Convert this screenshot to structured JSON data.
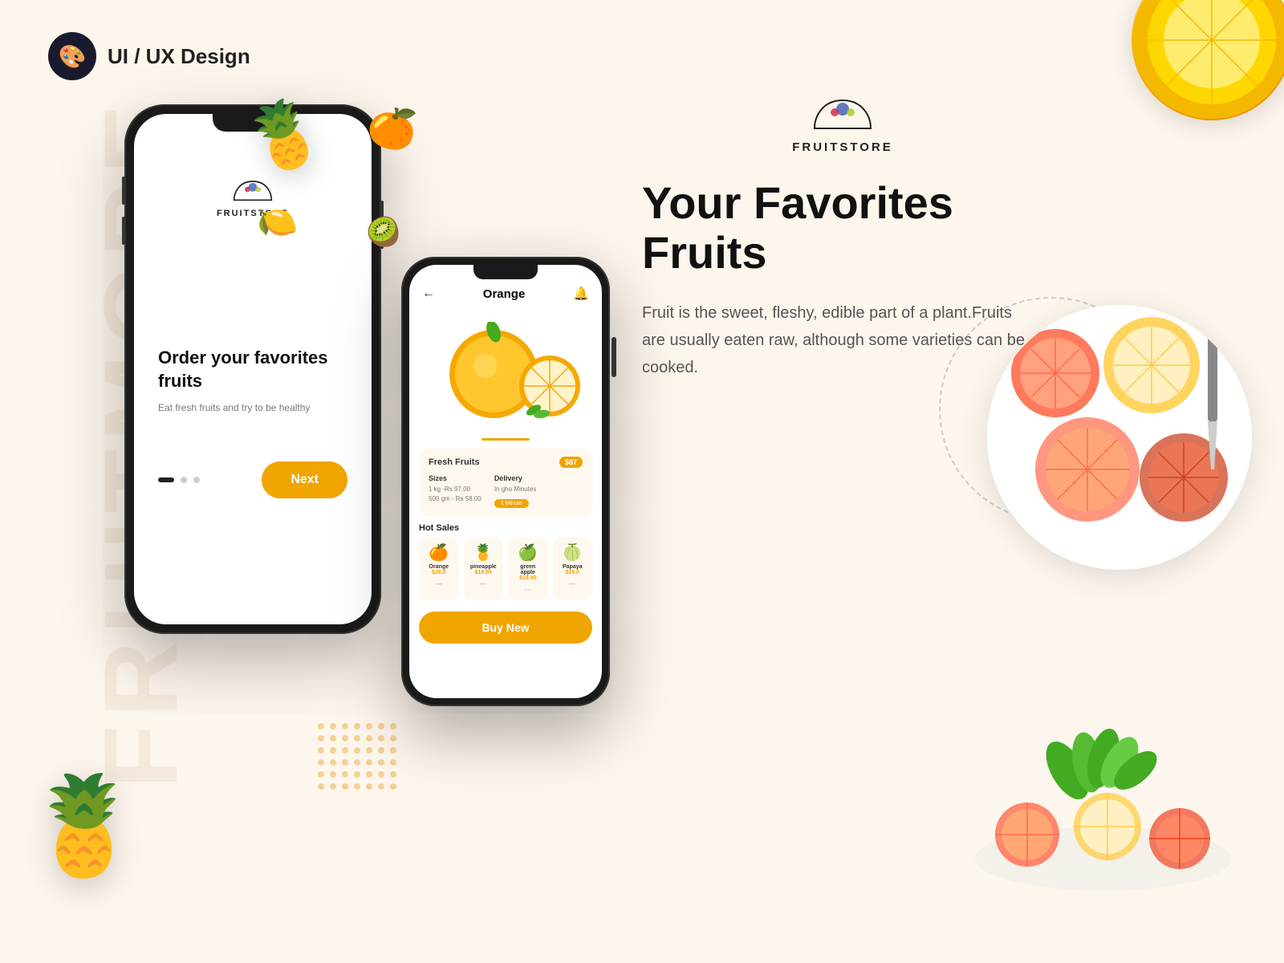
{
  "brand": {
    "logo_emoji": "🎨",
    "logo_label": "UI / UX Design",
    "fruitstore_name": "FRUITSTORE",
    "fruitstore_emoji": "🍇"
  },
  "watermark": {
    "text": "FRUITMORE"
  },
  "right": {
    "main_title": "Your Favorites Fruits",
    "description": "Fruit is the sweet, fleshy, edible part of a plant.Fruits are usually eaten raw, although some varieties can be cooked."
  },
  "phone1": {
    "logo_text": "FRUITSTORE",
    "tagline": "Order your favorites fruits",
    "sub": "Eat fresh fruits and try to be healthy",
    "next_label": "Next"
  },
  "phone2": {
    "title": "Orange",
    "card_label": "Fresh Fruits",
    "price_badge": "$87",
    "sizes_label": "Sizes",
    "size1": "1 kg -Rs 97.00",
    "size2": "500 gm - Rs 58.00",
    "delivery_label": "Delivery",
    "delivery_sub": "In gho Minutes",
    "delivery_badge": "1 Minute",
    "hot_sales": "Hot Sales",
    "fruits": [
      {
        "emoji": "🍊",
        "name": "Orange",
        "price": "$28.0"
      },
      {
        "emoji": "🍍",
        "name": "pineapple",
        "price": "$18.95"
      },
      {
        "emoji": "🍏",
        "name": "green apple",
        "price": "$18.45"
      },
      {
        "emoji": "🍈",
        "name": "Papaya",
        "price": "$29.0"
      }
    ],
    "buy_label": "Buy New"
  },
  "colors": {
    "accent": "#f0a500",
    "bg": "#fdf6ed",
    "dark": "#1a1a1a",
    "text": "#222"
  }
}
